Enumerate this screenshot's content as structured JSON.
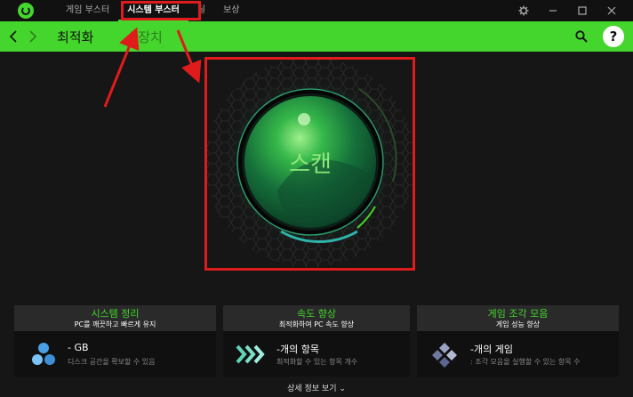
{
  "titlebar": {
    "tabs": [
      {
        "label": "게임 부스터"
      },
      {
        "label": "시스템 부스터"
      },
      {
        "label": "딜"
      },
      {
        "label": "보상"
      }
    ]
  },
  "navbar": {
    "tabs": [
      {
        "label": "최적화"
      },
      {
        "label": "| 장치"
      }
    ]
  },
  "scan": {
    "label": "스캔"
  },
  "cards": [
    {
      "title": "시스템 정리",
      "subtitle": "PC를 깨끗하고 빠르게 유지",
      "value": "- GB",
      "desc": "디스크 공간을 확보할 수 있음"
    },
    {
      "title": "속도 향상",
      "subtitle": "최적화하여 PC 속도 향상",
      "value": "-개의 항목",
      "desc": "최적화할 수 있는 항목 개수"
    },
    {
      "title": "게임 조각 모음",
      "subtitle": "게임 성능 향상",
      "value": "-개의 게임",
      "desc": ": 조각 모음을 실행할 수 있는 항목 수"
    }
  ],
  "details": {
    "label": "상세 정보 보기 ⌄"
  },
  "colors": {
    "accent": "#44d62c",
    "annotation": "#e01b1b"
  }
}
